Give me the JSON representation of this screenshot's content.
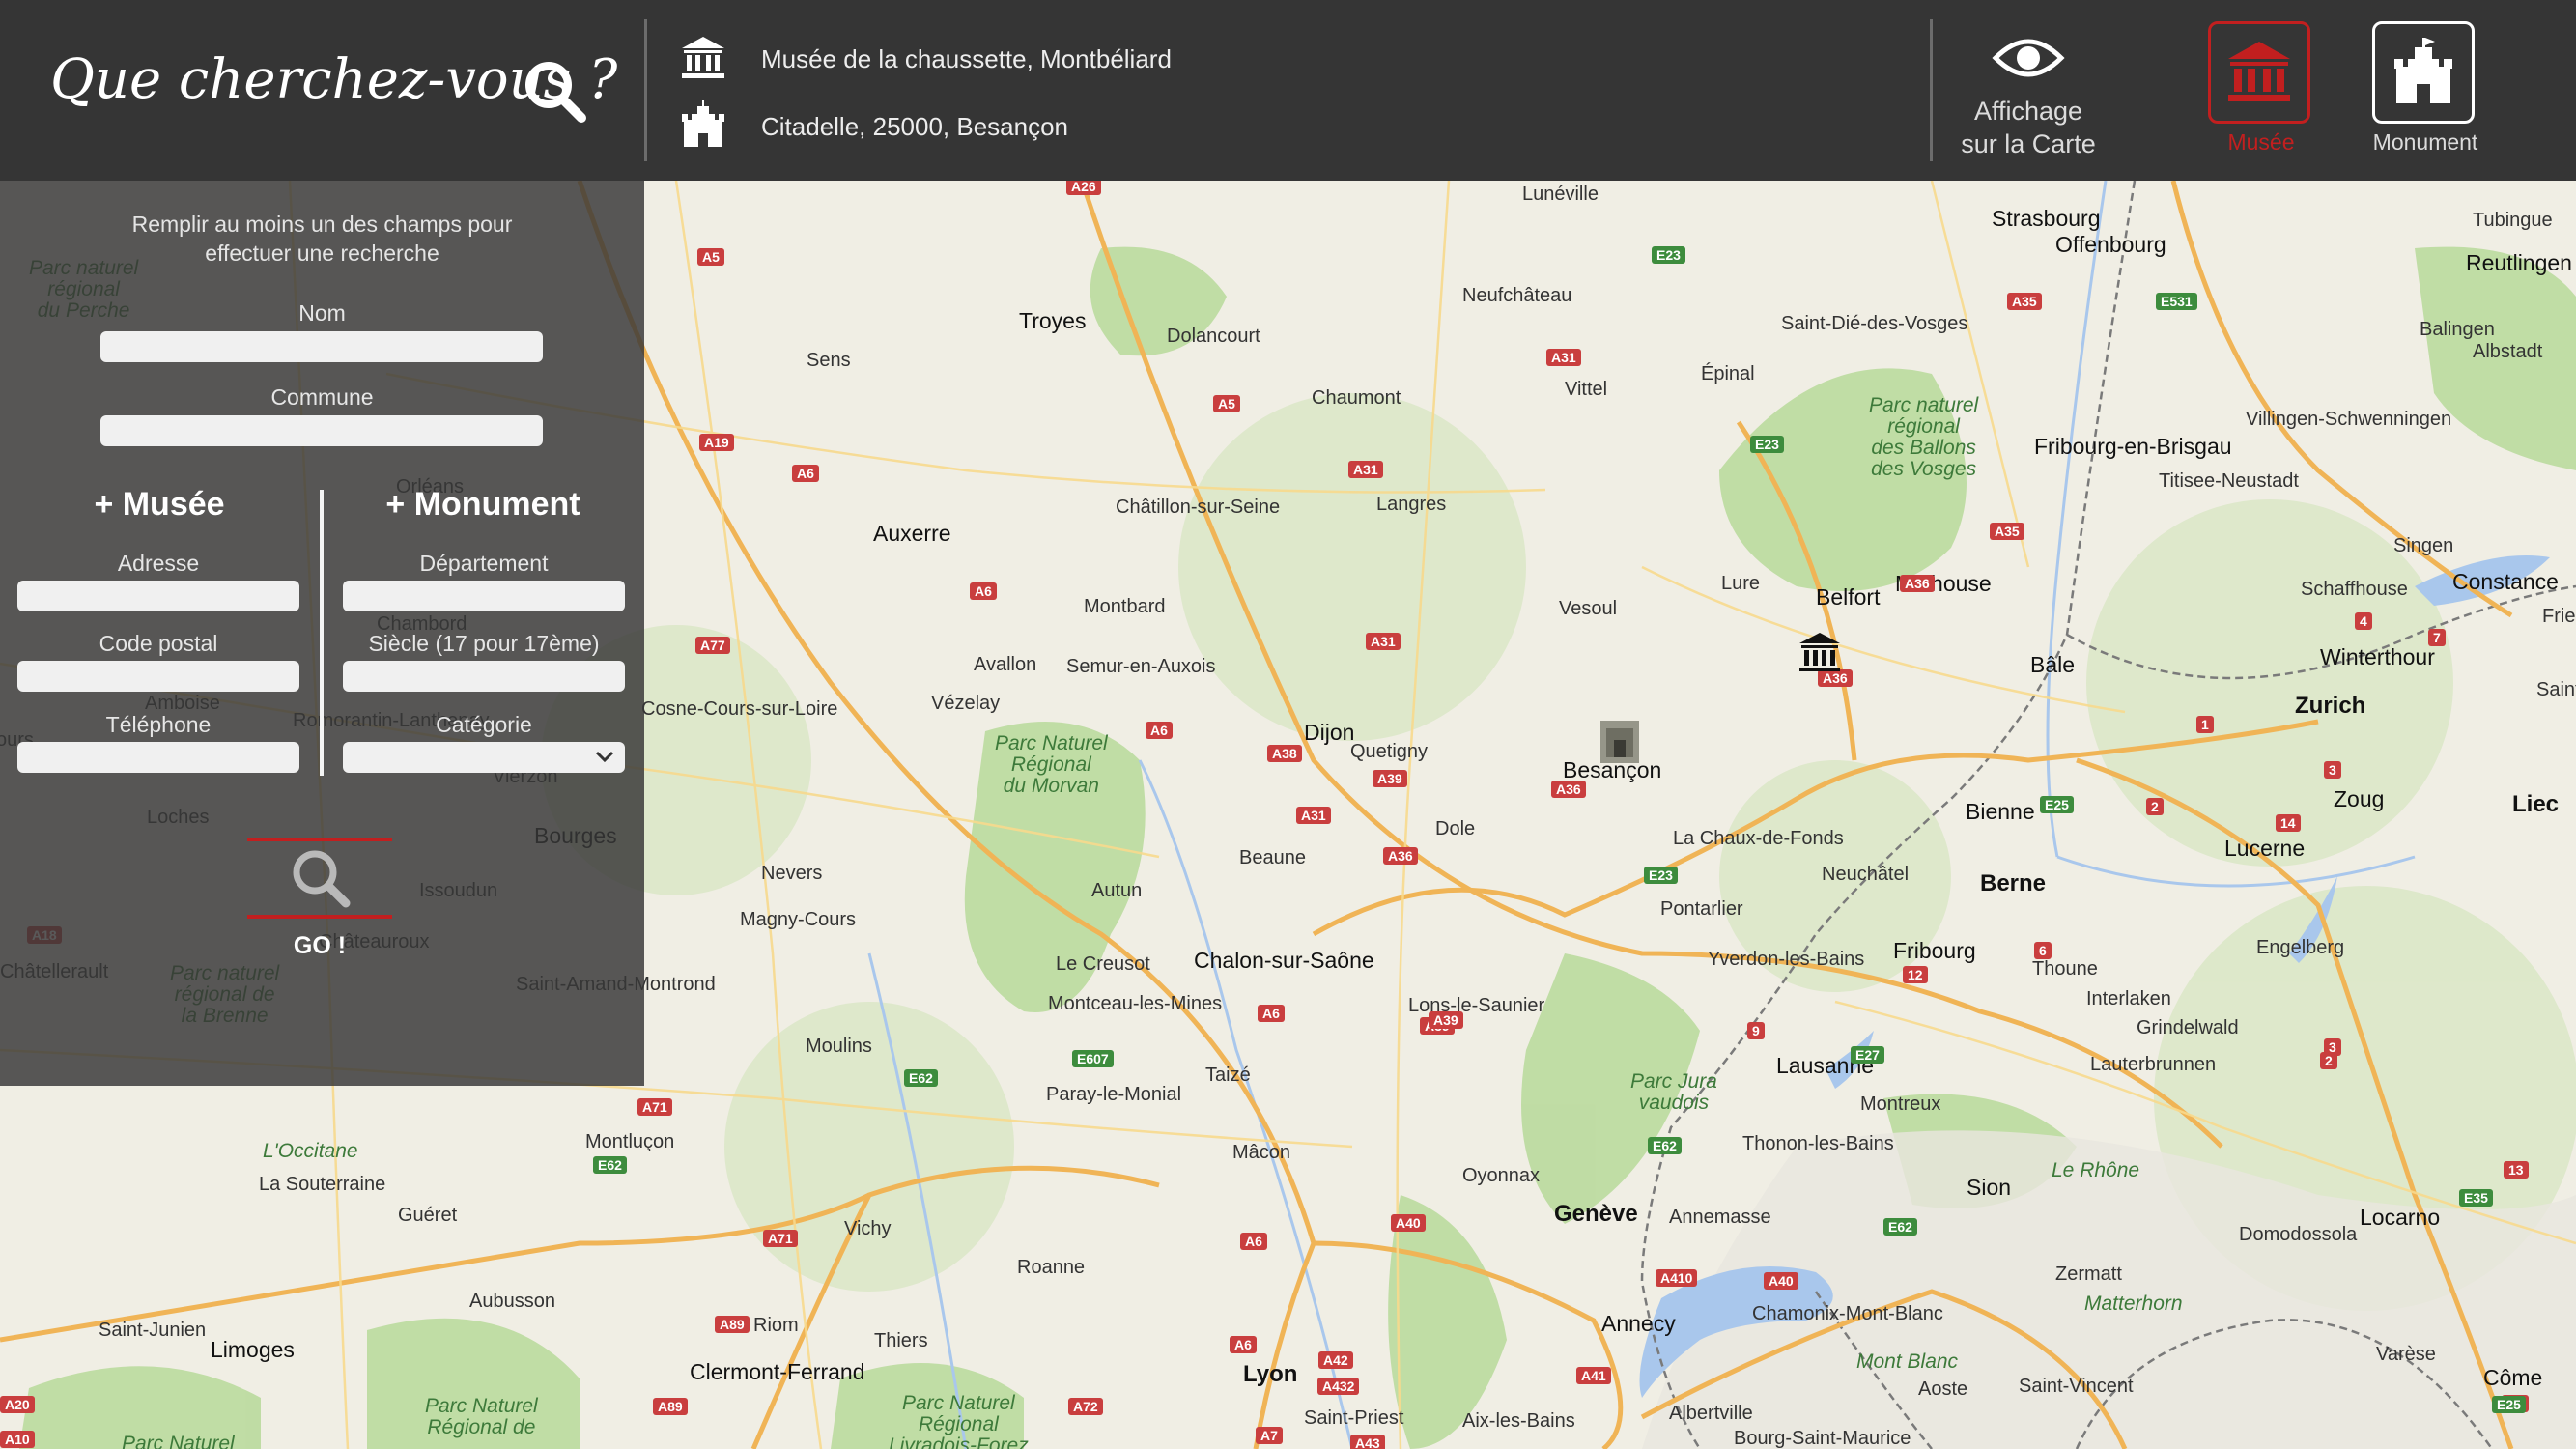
{
  "header": {
    "brand": "Que cherchez-vous ?",
    "results": [
      {
        "type": "musee",
        "text": "Musée de la chaussette, Montbéliard"
      },
      {
        "type": "monument",
        "text": "Citadelle, 25000, Besançon"
      }
    ],
    "map_toggle": {
      "line1": "Affichage",
      "line2": "sur la Carte"
    },
    "filters": {
      "musee": "Musée",
      "monument": "Monument"
    }
  },
  "panel": {
    "hint": "Remplir au moins un des champs pour effectuer une recherche",
    "nom_label": "Nom",
    "commune_label": "Commune",
    "musee_title": "+ Musée",
    "monument_title": "+ Monument",
    "adresse_label": "Adresse",
    "code_postal_label": "Code postal",
    "telephone_label": "Téléphone",
    "departement_label": "Département",
    "siecle_label": "Siècle (17 pour 17ème)",
    "categorie_label": "Catégorie",
    "go_label": "GO !"
  },
  "map": {
    "places": [
      {
        "name": "Strasbourg"
      },
      {
        "name": "Offenbourg"
      },
      {
        "name": "Lunéville"
      },
      {
        "name": "Tubingue"
      },
      {
        "name": "Reutlingen"
      },
      {
        "name": "Saint-Dié-des-Vosges"
      },
      {
        "name": "Neufchâteau"
      },
      {
        "name": "Épinal"
      },
      {
        "name": "Vittel"
      },
      {
        "name": "Troyes"
      },
      {
        "name": "Sens"
      },
      {
        "name": "Dolancourt"
      },
      {
        "name": "Chaumont"
      },
      {
        "name": "Langres"
      },
      {
        "name": "Châtillon-sur-Seine"
      },
      {
        "name": "Auxerre"
      },
      {
        "name": "Montbard"
      },
      {
        "name": "Avallon"
      },
      {
        "name": "Semur-en-Auxois"
      },
      {
        "name": "Vézelay"
      },
      {
        "name": "Dijon"
      },
      {
        "name": "Quetigny"
      },
      {
        "name": "Vesoul"
      },
      {
        "name": "Lure"
      },
      {
        "name": "Belfort"
      },
      {
        "name": "Mulhouse"
      },
      {
        "name": "Bâle"
      },
      {
        "name": "Fribourg-en-Brisgau"
      },
      {
        "name": "Titisee-Neustadt"
      },
      {
        "name": "Villingen-Schwenningen"
      },
      {
        "name": "Balingen"
      },
      {
        "name": "Albstadt"
      },
      {
        "name": "Singen"
      },
      {
        "name": "Schaffhouse"
      },
      {
        "name": "Constance"
      },
      {
        "name": "Winterthour"
      },
      {
        "name": "Zurich"
      },
      {
        "name": "Zoug"
      },
      {
        "name": "Lucerne"
      },
      {
        "name": "Liec"
      },
      {
        "name": "Saint-G"
      },
      {
        "name": "Friedri"
      },
      {
        "name": "Besançon"
      },
      {
        "name": "Dole"
      },
      {
        "name": "Beaune"
      },
      {
        "name": "Autun"
      },
      {
        "name": "Le Creusot"
      },
      {
        "name": "Chalon-sur-Saône"
      },
      {
        "name": "Montceau-les-Mines"
      },
      {
        "name": "Lons-le-Saunier"
      },
      {
        "name": "La Chaux-de-Fonds"
      },
      {
        "name": "Neuchâtel"
      },
      {
        "name": "Bienne"
      },
      {
        "name": "Berne"
      },
      {
        "name": "Pontarlier"
      },
      {
        "name": "Yverdon-les-Bains"
      },
      {
        "name": "Fribourg"
      },
      {
        "name": "Thoune"
      },
      {
        "name": "Interlaken"
      },
      {
        "name": "Engelberg"
      },
      {
        "name": "Grindelwald"
      },
      {
        "name": "Lauterbrunnen"
      },
      {
        "name": "Lausanne"
      },
      {
        "name": "Montreux"
      },
      {
        "name": "Thonon-les-Bains"
      },
      {
        "name": "Genève"
      },
      {
        "name": "Annemasse"
      },
      {
        "name": "Oyonnax"
      },
      {
        "name": "Sion"
      },
      {
        "name": "Locarno"
      },
      {
        "name": "Domodossola"
      },
      {
        "name": "Zermatt"
      },
      {
        "name": "Matterhorn"
      },
      {
        "name": "Mont Blanc"
      },
      {
        "name": "Chamonix-Mont-Blanc"
      },
      {
        "name": "Annecy"
      },
      {
        "name": "Aoste"
      },
      {
        "name": "Saint-Vincent"
      },
      {
        "name": "Varèse"
      },
      {
        "name": "Côme"
      },
      {
        "name": "Albertville"
      },
      {
        "name": "Bourg-Saint-Maurice"
      },
      {
        "name": "Aix-les-Bains"
      },
      {
        "name": "Lyon"
      },
      {
        "name": "Saint-Priest"
      },
      {
        "name": "Mâcon"
      },
      {
        "name": "Taizé"
      },
      {
        "name": "Paray-le-Monial"
      },
      {
        "name": "Moulins"
      },
      {
        "name": "Vichy"
      },
      {
        "name": "Roanne"
      },
      {
        "name": "Thiers"
      },
      {
        "name": "Riom"
      },
      {
        "name": "Clermont-Ferrand"
      },
      {
        "name": "Montluçon"
      },
      {
        "name": "Guéret"
      },
      {
        "name": "La Souterraine"
      },
      {
        "name": "Aubusson"
      },
      {
        "name": "Limoges"
      },
      {
        "name": "Saint-Junien"
      },
      {
        "name": "Nevers"
      },
      {
        "name": "Magny-Cours"
      },
      {
        "name": "Issoudun"
      },
      {
        "name": "Bourges"
      },
      {
        "name": "Châteauroux"
      },
      {
        "name": "Saint-Amand-Montrond"
      },
      {
        "name": "Châtellerault"
      },
      {
        "name": "Loches"
      },
      {
        "name": "Tours"
      },
      {
        "name": "Orléans"
      },
      {
        "name": "Chambord"
      },
      {
        "name": "Romorantin-Lanthenay"
      },
      {
        "name": "Vierzon"
      },
      {
        "name": "Amboise"
      },
      {
        "name": "Cosne-Cours-sur-Loire"
      }
    ],
    "regions": [
      {
        "name": "Parc Naturel Régional du Morvan"
      },
      {
        "name": "Parc naturel régional des Ballons des Vosges"
      },
      {
        "name": "Parc Jura vaudois"
      },
      {
        "name": "Parc naturel régional du Perche"
      },
      {
        "name": "Parc naturel régional de la Brenne"
      },
      {
        "name": "Parc Naturel Régional Livradois-Forez"
      },
      {
        "name": "Parc Naturel Régional de Millevaches"
      },
      {
        "name": "Parc Naturel"
      },
      {
        "name": "Le Rhône"
      },
      {
        "name": "L'Occitane"
      }
    ],
    "shields": [
      "A26",
      "A5",
      "E23",
      "A35",
      "E531",
      "A31",
      "A19",
      "A5",
      "A6",
      "E23",
      "A31",
      "A36",
      "A35",
      "A77",
      "A6",
      "A31",
      "A6",
      "A38",
      "A39",
      "A31",
      "A36",
      "A36",
      "E25",
      "A36",
      "E23",
      "A6",
      "E607",
      "A39",
      "E62",
      "A71",
      "E62",
      "A71",
      "A89",
      "A89",
      "A72",
      "A6",
      "A42",
      "A432",
      "A40",
      "A40",
      "A410",
      "A41",
      "E62",
      "E27",
      "A1",
      "A6",
      "A7",
      "A43",
      "A39",
      "A10",
      "A20",
      "A18",
      "A71",
      "E35",
      "13",
      "2",
      "3",
      "4",
      "7",
      "1",
      "14",
      "6",
      "12",
      "9",
      "3",
      "2",
      "E62",
      "E25"
    ]
  }
}
